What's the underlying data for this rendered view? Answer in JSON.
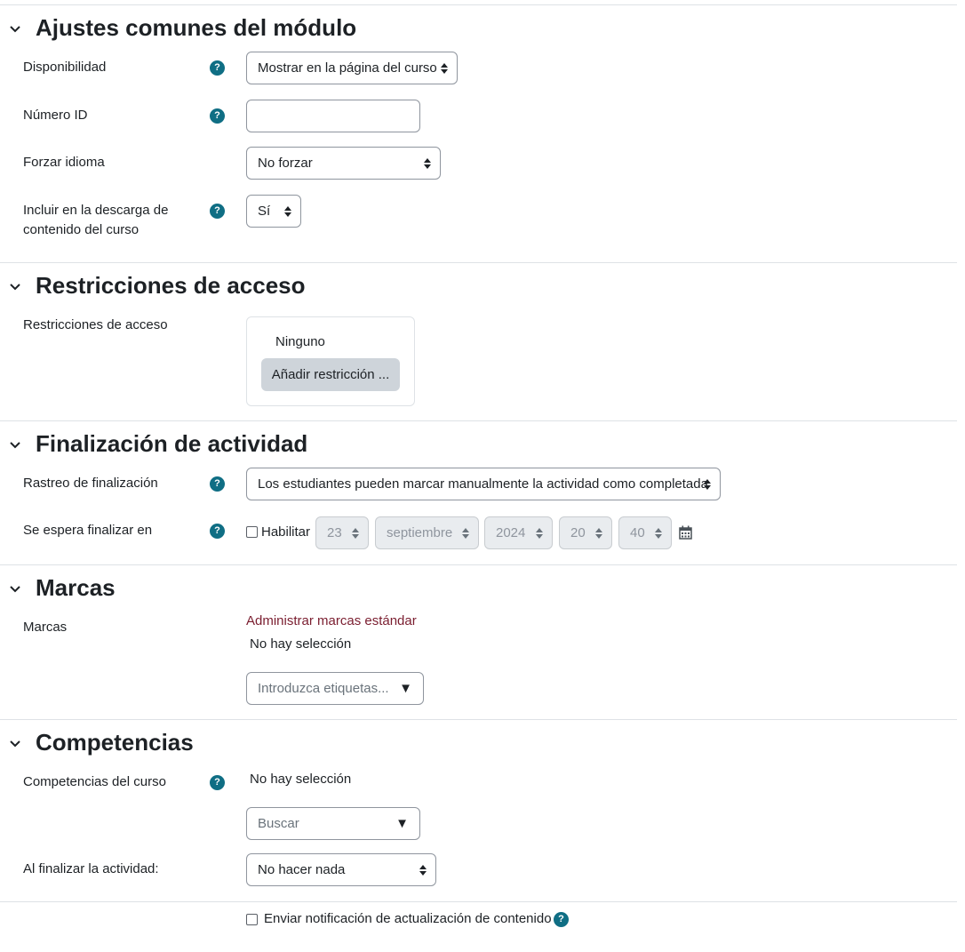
{
  "sections": {
    "common": {
      "title": "Ajustes comunes del módulo"
    },
    "restrictions": {
      "title": "Restricciones de acceso"
    },
    "completion": {
      "title": "Finalización de actividad"
    },
    "tags": {
      "title": "Marcas"
    },
    "competencies": {
      "title": "Competencias"
    }
  },
  "common": {
    "availability": {
      "label": "Disponibilidad",
      "value": "Mostrar en la página del curso"
    },
    "id_number": {
      "label": "Número ID",
      "value": ""
    },
    "force_language": {
      "label": "Forzar idioma",
      "value": "No forzar"
    },
    "include_download": {
      "label": "Incluir en la descarga de contenido del curso",
      "value": "Sí"
    }
  },
  "restrictions": {
    "label": "Restricciones de acceso",
    "none_text": "Ninguno",
    "add_button": "Añadir restricción ..."
  },
  "completion": {
    "tracking": {
      "label": "Rastreo de finalización",
      "value": "Los estudiantes pueden marcar manualmente la actividad como completada"
    },
    "expected": {
      "label": "Se espera finalizar en",
      "enable_label": "Habilitar",
      "enabled": false,
      "day": "23",
      "month": "septiembre",
      "year": "2024",
      "hour": "20",
      "minute": "40"
    }
  },
  "tags": {
    "label": "Marcas",
    "manage_link": "Administrar marcas estándar",
    "no_selection": "No hay selección",
    "placeholder": "Introduzca etiquetas..."
  },
  "competencies": {
    "course_label": "Competencias del curso",
    "no_selection": "No hay selección",
    "search_placeholder": "Buscar",
    "on_complete": {
      "label": "Al finalizar la actividad:",
      "value": "No hacer nada"
    }
  },
  "notification": {
    "label": "Enviar notificación de actualización de contenido",
    "checked": false
  },
  "icons": {
    "help": "?",
    "dropdown_triangle": "▼"
  },
  "colors": {
    "help_icon": "#0f6e84",
    "link": "#7a1d2f",
    "button_secondary": "#ced4da"
  }
}
